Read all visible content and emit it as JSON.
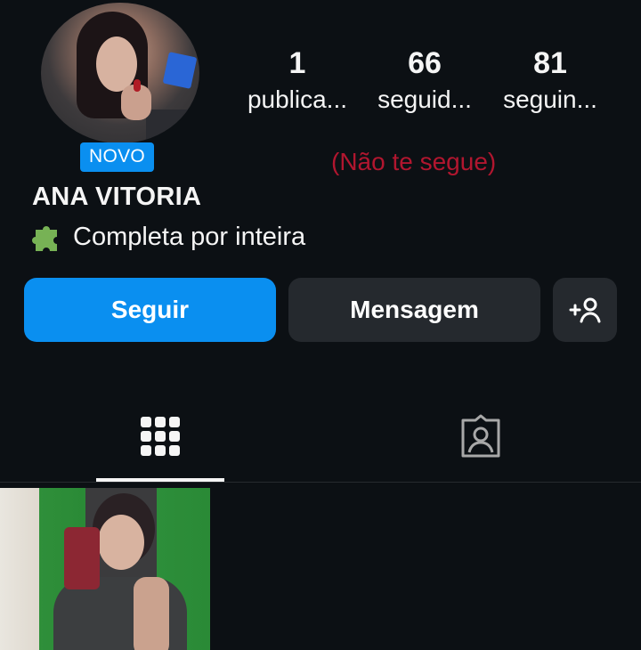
{
  "profile": {
    "badge": "NOVO",
    "name": "ANA VITORIA",
    "bio_emoji": "puzzle-icon",
    "bio_text": "Completa por inteira",
    "not_follow": "(Não te segue)"
  },
  "stats": [
    {
      "value": "1",
      "label": "publica..."
    },
    {
      "value": "66",
      "label": "seguid..."
    },
    {
      "value": "81",
      "label": "seguin..."
    }
  ],
  "actions": {
    "follow": "Seguir",
    "message": "Mensagem",
    "add_user_icon": "add-user-icon"
  },
  "tabs": [
    {
      "icon": "grid-icon",
      "active": true
    },
    {
      "icon": "tagged-icon",
      "active": false
    }
  ],
  "colors": {
    "background": "#0c1014",
    "primary": "#0a8ff0",
    "secondary_button": "#25292e",
    "not_follow_text": "#b1162f"
  }
}
